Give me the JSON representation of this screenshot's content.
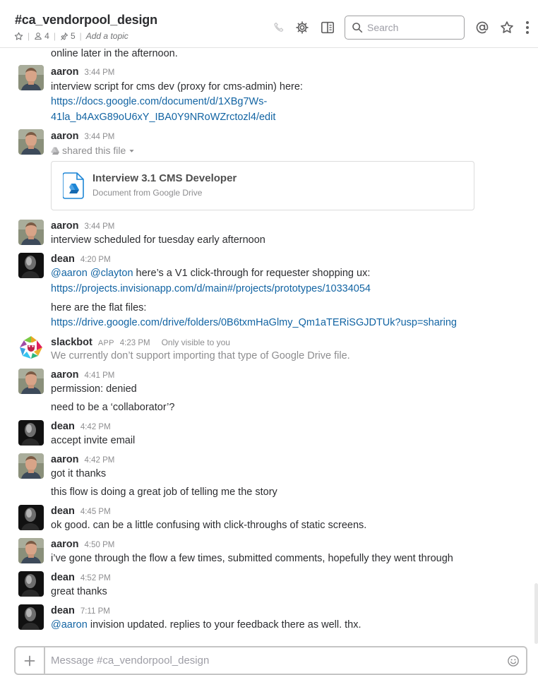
{
  "header": {
    "channel_name": "#ca_vendorpool_design",
    "member_count": "4",
    "pinned_count": "5",
    "topic_placeholder": "Add a topic",
    "search_placeholder": "Search"
  },
  "icons": {
    "star": "star-icon",
    "members": "person-icon",
    "pin": "pin-icon",
    "call": "phone-icon",
    "settings": "gear-icon",
    "details": "sidebar-icon",
    "mentions": "at-sign-icon",
    "starred": "star-icon",
    "more": "kebab-icon"
  },
  "messages": {
    "top_fragment": "online later in the afternoon.",
    "m1": {
      "author": "aaron",
      "time": "3:44 PM",
      "text": "interview script for cms dev (proxy for cms-admin) here:",
      "link_line1": "https://docs.google.com/document/d/1XBg7Ws-",
      "link_line2": "41la_b4AxG89oU6xY_IBA0Y9NRoWZrctozl4/edit"
    },
    "m2": {
      "author": "aaron",
      "time": "3:44 PM",
      "shared": "shared this file",
      "file_title": "Interview 3.1 CMS Developer",
      "file_source": "Document from Google Drive"
    },
    "m3": {
      "author": "aaron",
      "time": "3:44 PM",
      "text": "interview scheduled for tuesday early afternoon"
    },
    "m4": {
      "author": "dean",
      "time": "4:20 PM",
      "mention1": "@aaron",
      "mention2": "@clayton",
      "text": "here’s a V1 click-through for requester shopping ux:",
      "link1": "https://projects.invisionapp.com/d/main#/projects/prototypes/10334054",
      "text2": "here are the flat files:",
      "link2": "https://drive.google.com/drive/folders/0B6txmHaGlmy_Qm1aTERiSGJDTUk?usp=sharing"
    },
    "m5": {
      "author": "slackbot",
      "badge": "APP",
      "time": "4:23 PM",
      "visibility": "Only visible to you",
      "text": "We currently don’t support importing that type of Google Drive file."
    },
    "m6": {
      "author": "aaron",
      "time": "4:41 PM",
      "text": "permission: denied",
      "text2": "need to be a ‘collaborator’?"
    },
    "m7": {
      "author": "dean",
      "time": "4:42 PM",
      "text": "accept invite email"
    },
    "m8": {
      "author": "aaron",
      "time": "4:42 PM",
      "text": "got it thanks",
      "text2": "this flow is doing a great job of telling me the story"
    },
    "m9": {
      "author": "dean",
      "time": "4:45 PM",
      "text": "ok good. can be a little confusing with click-throughs of static screens."
    },
    "m10": {
      "author": "aaron",
      "time": "4:50 PM",
      "text": "i’ve gone through the flow a few times, submitted comments, hopefully they went through"
    },
    "m11": {
      "author": "dean",
      "time": "4:52 PM",
      "text": "great thanks"
    },
    "m12": {
      "author": "dean",
      "time": "7:11 PM",
      "mention": "@aaron",
      "text": "invision updated. replies to your feedback there as well. thx."
    }
  },
  "composer": {
    "placeholder": "Message #ca_vendorpool_design"
  },
  "colors": {
    "link": "#1264a3",
    "text": "#2c2d30",
    "muted": "#8d8d8f",
    "border": "#c5c5c5"
  }
}
